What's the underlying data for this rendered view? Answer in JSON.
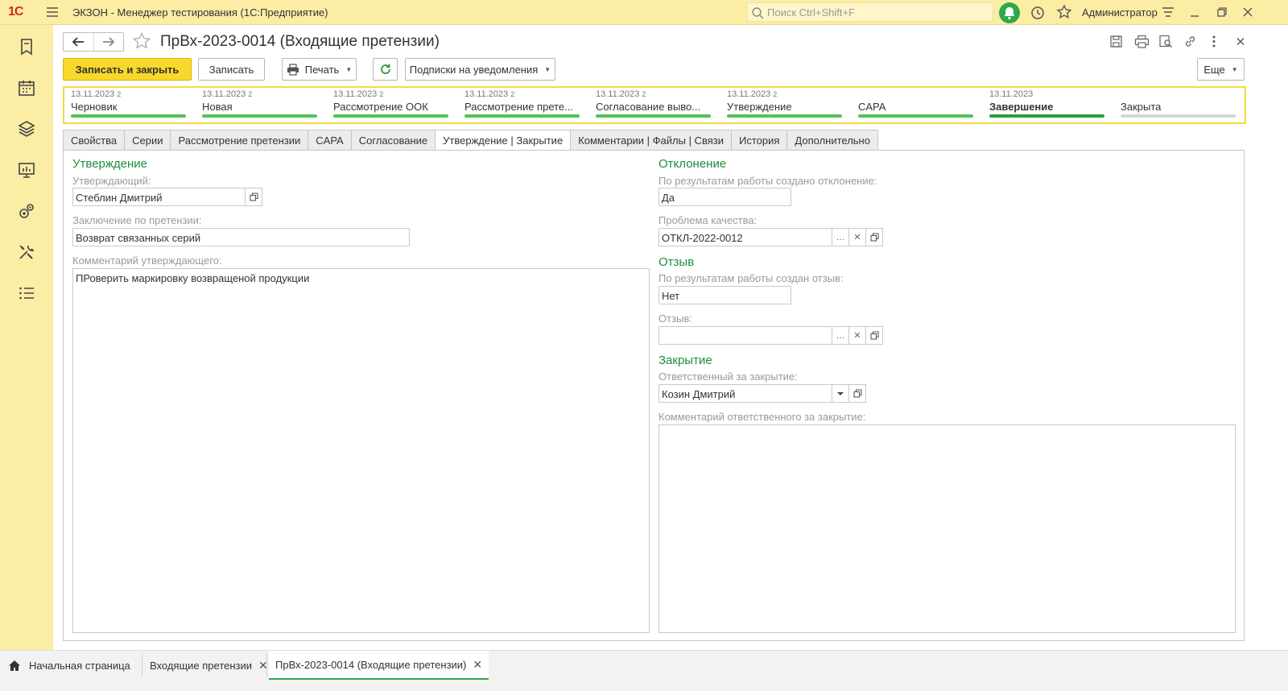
{
  "topbar": {
    "logo_text": "1С",
    "app_title": "ЭКЗОН  - Менеджер тестирования (1С:Предприятие)",
    "search_placeholder": "Поиск Ctrl+Shift+F",
    "user": "Администратор"
  },
  "sidebar": {
    "items": [
      {
        "icon": "bookmark-icon"
      },
      {
        "icon": "calendar-icon"
      },
      {
        "icon": "layers-icon"
      },
      {
        "icon": "chart-board-icon"
      },
      {
        "icon": "gears-icon"
      },
      {
        "icon": "tools-icon"
      },
      {
        "icon": "list-icon"
      }
    ]
  },
  "form": {
    "title": "ПрВх-2023-0014 (Входящие претензии)",
    "toolbar": {
      "save_close": "Записать и закрыть",
      "save": "Записать",
      "print": "Печать",
      "subscriptions": "Подписки на уведомления",
      "more": "Еще"
    },
    "stages": [
      {
        "date": "13.11.2023",
        "count": "2",
        "name": "Черновик",
        "state": "done"
      },
      {
        "date": "13.11.2023",
        "count": "2",
        "name": "Новая",
        "state": "done"
      },
      {
        "date": "13.11.2023",
        "count": "2",
        "name": "Рассмотрение ООК",
        "state": "done"
      },
      {
        "date": "13.11.2023",
        "count": "2",
        "name": "Рассмотрение прете...",
        "state": "done"
      },
      {
        "date": "13.11.2023",
        "count": "2",
        "name": "Согласование выво...",
        "state": "done"
      },
      {
        "date": "13.11.2023",
        "count": "2",
        "name": "Утверждение",
        "state": "done"
      },
      {
        "date": "",
        "count": "",
        "name": "CAPA",
        "state": "done"
      },
      {
        "date": "13.11.2023",
        "count": "",
        "name": "Завершение",
        "state": "current"
      },
      {
        "date": "",
        "count": "",
        "name": "Закрыта",
        "state": "pending"
      }
    ],
    "tabs": [
      "Свойства",
      "Серии",
      "Рассмотрение претензии",
      "CAPA",
      "Согласование",
      "Утверждение | Закрытие",
      "Комментарии | Файлы | Связи",
      "История",
      "Дополнительно"
    ],
    "active_tab": "Утверждение | Закрытие"
  },
  "approval": {
    "section": "Утверждение",
    "approver_label": "Утверждающий:",
    "approver_value": "Стеблин Дмитрий",
    "conclusion_label": "Заключение по претензии:",
    "conclusion_value": "Возврат связанных серий",
    "comment_label": "Комментарий утверждающего:",
    "comment_value": "ПРоверить маркировку возвращеной продукции"
  },
  "deviation": {
    "section": "Отклонение",
    "created_label": "По результатам работы создано отклонение:",
    "created_value": "Да",
    "problem_label": "Проблема качества:",
    "problem_value": "ОТКЛ-2022-0012"
  },
  "recall": {
    "section": "Отзыв",
    "created_label": "По результатам работы создан отзыв:",
    "created_value": "Нет",
    "recall_label": "Отзыв:",
    "recall_value": ""
  },
  "closing": {
    "section": "Закрытие",
    "responsible_label": "Ответственный за закрытие:",
    "responsible_value": "Козин Дмитрий",
    "comment_label": "Комментарий ответственного за закрытие:",
    "comment_value": ""
  },
  "taskbar": {
    "home": "Начальная страница",
    "tab1": "Входящие претензии",
    "tab2": "ПрВх-2023-0014 (Входящие претензии)"
  },
  "colors": {
    "accent_yellow": "#fbeda4",
    "primary_button": "#f8d82a",
    "section_green": "#1e8c3c",
    "stage_done": "#55c25a"
  }
}
